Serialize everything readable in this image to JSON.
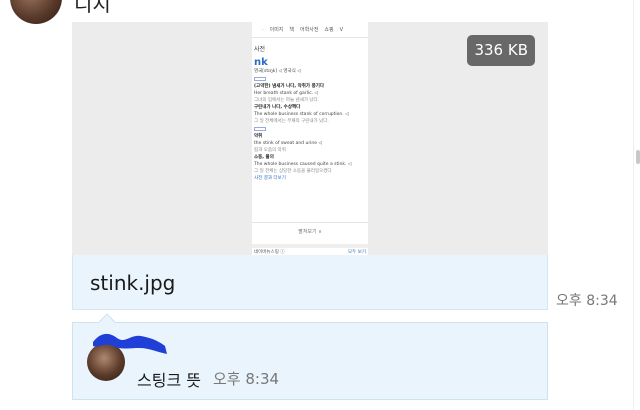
{
  "sender": {
    "name": "디지"
  },
  "attachment": {
    "size": "336 KB",
    "filename": "stink.jpg",
    "timestamp": "오후 8:34",
    "preview": {
      "tabs": [
        "이미지",
        "책",
        "어학사전",
        "쇼핑",
        "V"
      ],
      "dict_label": "사전",
      "word": "nk",
      "lines": [
        "  영국[stɪŋk]  ◁  영국식  ◁",
        "(고약한) 냄새가 나다, 악취가 풍기다",
        "Her breath stank of garlic. ◁",
        "그녀의 입에서는 마늘 냄새가 났다.",
        "구린내가 나다, 수상쩍다",
        "The whole business stank of corruption. ◁",
        "그 일 전체에서는 부패의 구린내가 났다.",
        "악취",
        "the stink of sweat and urine ◁",
        "땀과 오줌의 악취",
        "소동, 물의",
        "The whole business caused quite a stink. ◁",
        "그 일 전체는 상당한 소동을 불러일으켰다",
        "사전 결과 더보기"
      ],
      "fold_label": "펼쳐보기 ∨",
      "bottom_left": "네이버뉴스핑 ⓘ",
      "bottom_right": "모두 보기"
    }
  },
  "reply": {
    "text": "스팅크 뜻",
    "timestamp": "오후 8:34"
  },
  "colors": {
    "bubble": "#eaf4fc",
    "badge": "#686868",
    "redaction": "#1f3fd6"
  }
}
